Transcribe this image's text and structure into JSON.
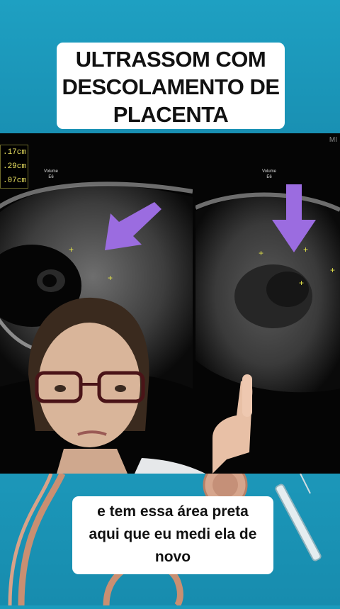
{
  "title": {
    "lines": [
      "ULTRASSOM COM",
      "DESCOLAMENTO DE",
      "PLACENTA"
    ]
  },
  "ultrasound": {
    "mi_label": "MI",
    "measurements": [
      ".17cm",
      ".29cm",
      ".07cm"
    ],
    "left_panel_label": [
      "Volume",
      "E6"
    ],
    "right_panel_label": [
      "Volume",
      "E6"
    ],
    "arrow_color": "#9b6ce0",
    "caliper_color": "#e8e84a"
  },
  "subtitle": {
    "lines": [
      "e tem essa área preta",
      "aqui que eu medi ela de",
      "novo"
    ]
  },
  "colors": {
    "background": "#1a9bbd",
    "caption_bg": "#ffffff",
    "caption_text": "#111111"
  }
}
